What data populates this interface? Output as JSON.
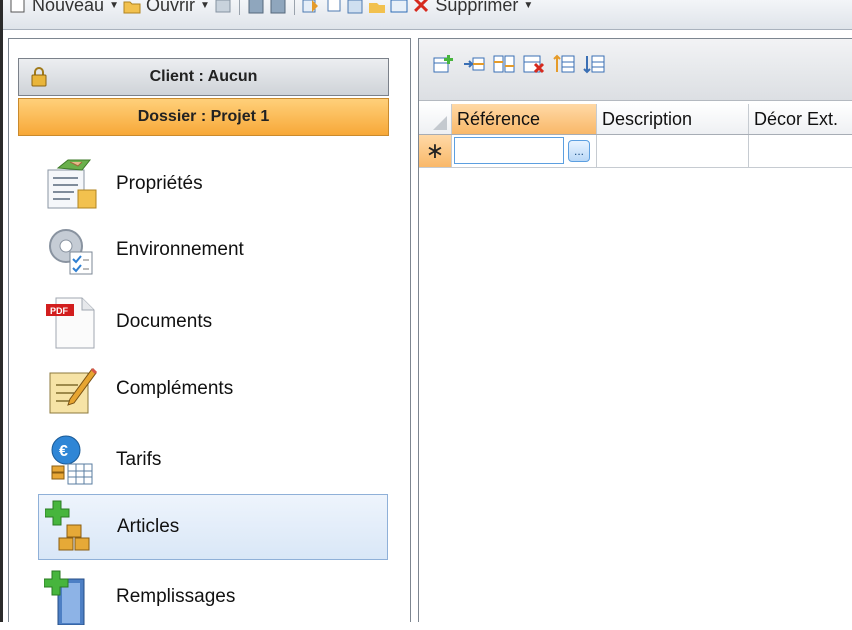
{
  "toolbar": {
    "new_label": "Nouveau",
    "open_label": "Ouvrir",
    "delete_label": "Supprimer"
  },
  "left_panel": {
    "client_label": "Client : Aucun",
    "dossier_label": "Dossier : Projet 1",
    "nav_items": [
      {
        "label": "Propriétés",
        "icon": "properties-icon"
      },
      {
        "label": "Environnement",
        "icon": "environment-icon"
      },
      {
        "label": "Documents",
        "icon": "pdf-document-icon"
      },
      {
        "label": "Compléments",
        "icon": "notepad-pencil-icon"
      },
      {
        "label": "Tarifs",
        "icon": "euro-pricing-icon"
      },
      {
        "label": "Articles",
        "icon": "add-articles-icon",
        "selected": true
      },
      {
        "label": "Remplissages",
        "icon": "add-fill-icon"
      }
    ]
  },
  "grid": {
    "columns": [
      "Référence",
      "Description",
      "Décor Ext."
    ],
    "new_row_marker": "∗",
    "ellipsis": "..."
  },
  "colors": {
    "selected_bg": "#d9e7f7",
    "dossier_bg": "#f7a838",
    "active_header": "#f9b869"
  }
}
